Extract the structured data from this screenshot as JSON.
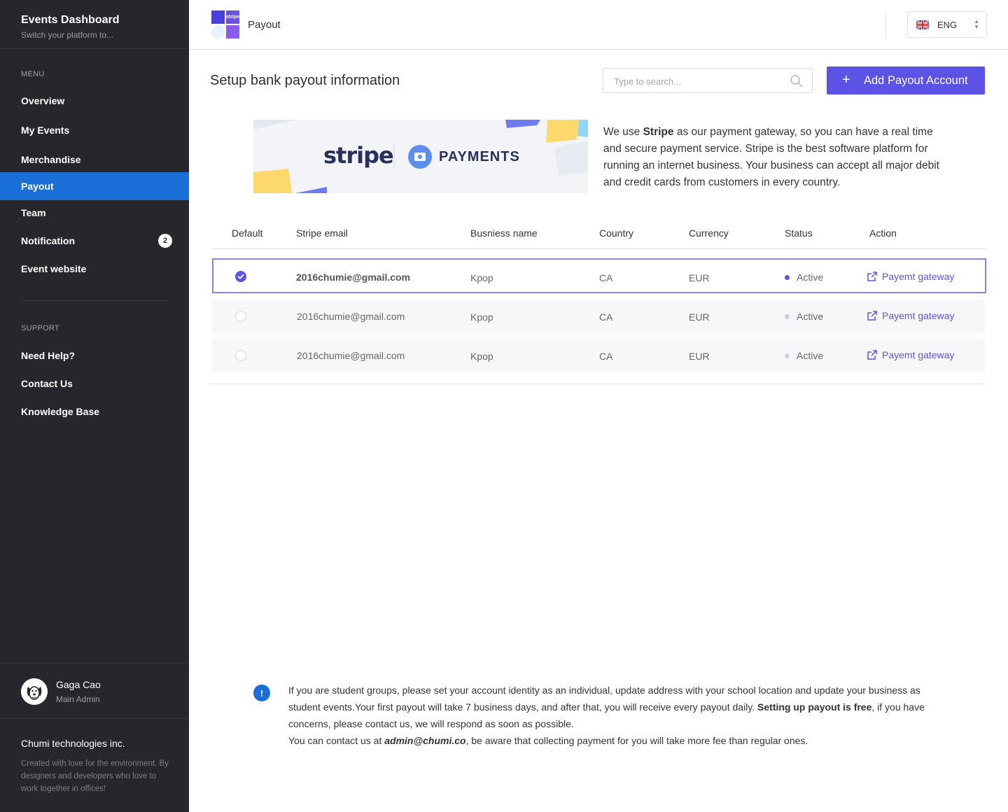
{
  "sidebar": {
    "brand_title": "Events Dashboard",
    "brand_subtitle": "Switch your platform to...",
    "menu_label": "MENU",
    "menu_items": [
      {
        "label": "Overview"
      },
      {
        "label": "My Events"
      },
      {
        "label": "Merchandise"
      },
      {
        "label": "Payout",
        "active": true
      },
      {
        "label": "Team"
      },
      {
        "label": "Notification",
        "badge": "2"
      },
      {
        "label": "Event website"
      }
    ],
    "support_label": "SUPPORT",
    "support_items": [
      {
        "label": "Need Help?"
      },
      {
        "label": "Contact Us"
      },
      {
        "label": "Knowledge Base"
      }
    ],
    "user": {
      "name": "Gaga Cao",
      "role": "Main Admin"
    },
    "company": "Chumi technologies inc.",
    "company_note": "Created with love for the environment. By designers and developers who love to work together in offices!"
  },
  "header": {
    "page_title": "Payout",
    "logo_text": "stripe",
    "language": "ENG"
  },
  "main": {
    "title": "Setup bank payout information",
    "search_placeholder": "Type to search...",
    "add_button_label": "Add Payout Account",
    "banner": {
      "left_text": "stripe",
      "right_text": "PAYMENTS"
    },
    "intro": {
      "prefix": "We use ",
      "bold": "Stripe",
      "suffix": " as our payment gateway, so you can have a real time and secure payment service. Stripe is the best software platform for running an internet business. Your business can accept all major debit and credit cards from customers in every country."
    },
    "table": {
      "headers": [
        "Default",
        "Stripe email",
        "Busniess name",
        "Country",
        "Currency",
        "Status",
        "Action"
      ],
      "rows": [
        {
          "default": true,
          "email": "2016chumie@gmail.com",
          "business": "Kpop",
          "country": "CA",
          "currency": "EUR",
          "status": "Active",
          "action": "Payemt gateway"
        },
        {
          "default": false,
          "email": "2016chumie@gmail.com",
          "business": "Kpop",
          "country": "CA",
          "currency": "EUR",
          "status": "Active",
          "action": "Payemt gateway"
        },
        {
          "default": false,
          "email": "2016chumie@gmail.com",
          "business": "Kpop",
          "country": "CA",
          "currency": "EUR",
          "status": "Active",
          "action": "Payemt gateway"
        }
      ]
    },
    "notice": {
      "part1": "If you are student groups, please set your account identity as an individual, update address with your school location and update your business as student events.Your first payout will take 7 business days, and after that, you will receive every payout daily. ",
      "bold": "Setting up payout is free",
      "part2": ", if you have concerns, please contact us, we will respond as soon as possible.",
      "contact_prefix": "You can contact us at ",
      "contact_email": "admin@chumi.co",
      "contact_suffix": ", be aware that collecting payment for you will take more fee than regular ones."
    }
  },
  "colors": {
    "sidebar_bg": "#26262c",
    "active_nav": "#1a6ed8",
    "accent": "#5d52e6"
  }
}
